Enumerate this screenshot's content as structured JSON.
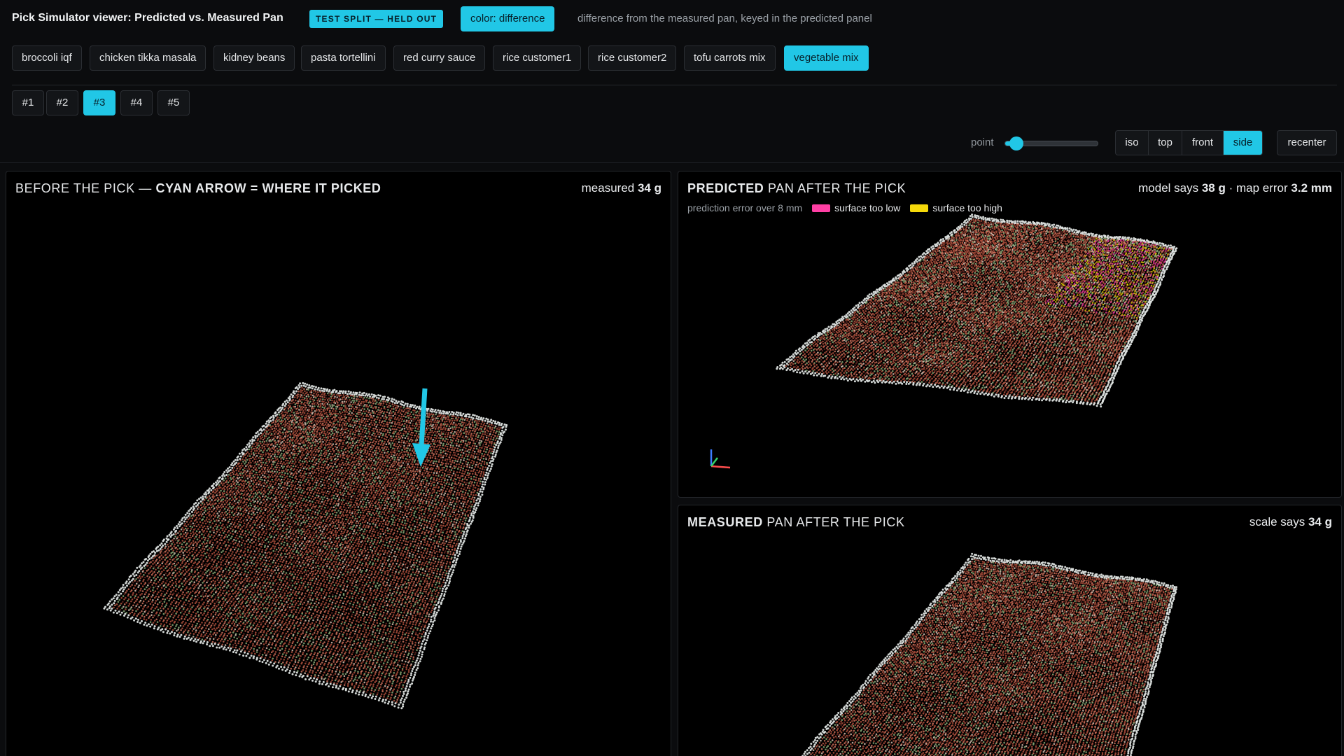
{
  "header": {
    "title": "Pick Simulator viewer: Predicted vs. Measured Pan",
    "split_badge": "TEST SPLIT — HELD OUT",
    "color_button": "color: difference",
    "color_description": "difference from the measured pan, keyed in the predicted panel"
  },
  "products": [
    {
      "label": "broccoli iqf",
      "active": false
    },
    {
      "label": "chicken tikka masala",
      "active": false
    },
    {
      "label": "kidney beans",
      "active": false
    },
    {
      "label": "pasta tortellini",
      "active": false
    },
    {
      "label": "red curry sauce",
      "active": false
    },
    {
      "label": "rice customer1",
      "active": false
    },
    {
      "label": "rice customer2",
      "active": false
    },
    {
      "label": "tofu carrots mix",
      "active": false
    },
    {
      "label": "vegetable mix",
      "active": true
    }
  ],
  "picks": [
    {
      "label": "#1",
      "active": false
    },
    {
      "label": "#2",
      "active": false
    },
    {
      "label": "#3",
      "active": true
    },
    {
      "label": "#4",
      "active": false
    },
    {
      "label": "#5",
      "active": false
    }
  ],
  "controls": {
    "point_label": "point",
    "point_size_fraction": 0.12,
    "views": [
      {
        "label": "iso",
        "active": false
      },
      {
        "label": "top",
        "active": false
      },
      {
        "label": "front",
        "active": false
      },
      {
        "label": "side",
        "active": true
      }
    ],
    "recenter": "recenter"
  },
  "panels": {
    "before": {
      "title_normal": "BEFORE THE PICK — ",
      "title_bold": "CYAN ARROW = WHERE IT PICKED",
      "right_prefix": "measured ",
      "right_value": "34 g"
    },
    "predicted": {
      "title_bold": "PREDICTED",
      "title_normal": " PAN AFTER THE PICK",
      "right_prefix": "model says ",
      "right_value1": "38 g",
      "right_mid": " · map error ",
      "right_value2": "3.2 mm",
      "legend_caption": "prediction error over 8 mm",
      "legend_low": "surface too low",
      "legend_high": "surface too high",
      "color_low": "#ff3fa4",
      "color_high": "#f5d90a"
    },
    "measured": {
      "title_bold": "MEASURED",
      "title_normal": " PAN AFTER THE PICK",
      "right_prefix": "scale says ",
      "right_value": "34 g"
    }
  },
  "colors": {
    "accent": "#21c7e6",
    "background": "#0b0c0e",
    "panel_bg": "#000000"
  }
}
